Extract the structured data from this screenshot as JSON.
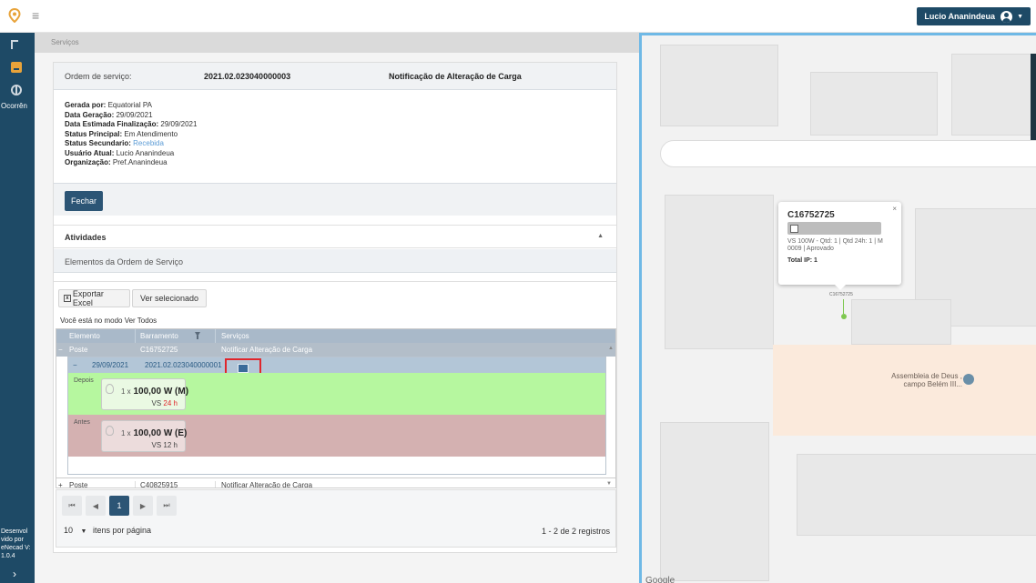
{
  "header": {
    "user_name": "Lucio Ananindeua"
  },
  "sidebar": {
    "label": "Ocorrên",
    "footer": "Desenvol vido por eNecad V: 1.0.4"
  },
  "breadcrumb": "Serviços",
  "order": {
    "label": "Ordem de serviço:",
    "number": "2021.02.023040000003",
    "title": "Notificação de Alteração de Carga",
    "fields": [
      {
        "key": "Gerada por:",
        "value": "Equatorial PA"
      },
      {
        "key": "Data Geração:",
        "value": "29/09/2021"
      },
      {
        "key": "Data Estimada Finalização:",
        "value": "29/09/2021"
      },
      {
        "key": "Status Principal:",
        "value": "Em Atendimento"
      },
      {
        "key": "Status Secundario:",
        "value": "Recebida"
      },
      {
        "key": "Usuário Atual:",
        "value": "Lucio Ananindeua"
      },
      {
        "key": "Organização:",
        "value": "Pref.Ananindeua"
      }
    ],
    "close_label": "Fechar"
  },
  "activities": {
    "title": "Atividades",
    "elements_title": "Elementos da Ordem de Serviço"
  },
  "toolbar": {
    "export_label": "Exportar Excel",
    "view_selected_label": "Ver selecionado",
    "mode_text": "Você está no modo Ver Todos"
  },
  "grid": {
    "columns": [
      "Elemento",
      "Barramento",
      "Serviços"
    ],
    "group1": {
      "toggle": "−",
      "element": "Poste",
      "code": "C16752725",
      "service": "Notificar Alteração de Carga"
    },
    "detail": {
      "toggle": "−",
      "date": "29/09/2021",
      "order_number": "2021.02.023040000001"
    },
    "after": {
      "label": "Depois",
      "qty": "1 x",
      "power": "100,00 W (M)",
      "type": "VS",
      "hours": "24 h"
    },
    "before": {
      "label": "Antes",
      "qty": "1 x",
      "power": "100,00 W (E)",
      "type": "VS",
      "hours": "12 h"
    },
    "group2": {
      "toggle": "+",
      "element": "Poste",
      "code": "C40825915",
      "service": "Notificar Alteração de Carga"
    }
  },
  "pager": {
    "first": "⏮",
    "prev": "◀",
    "current": "1",
    "next": "▶",
    "last": "⏭",
    "page_size": "10",
    "page_size_label": "itens por página",
    "info": "1 - 2 de 2 registros"
  },
  "map": {
    "popup": {
      "title": "C16752725",
      "line1": "VS 100W - Qtd: 1 | Qtd 24h: 1 | M 0009 | Aprovado",
      "total": "Total IP: 1"
    },
    "marker_label": "C16752725",
    "place_label": "Assembleia de Deus , campo Belém III...",
    "attribution": "Google"
  },
  "colors": {
    "primary": "#1e4a66",
    "button": "#2c5575",
    "after_bg": "#b6f79f",
    "before_bg": "#d4b1b1",
    "highlight": "#e0262b",
    "map_border": "#6fb9e6"
  }
}
